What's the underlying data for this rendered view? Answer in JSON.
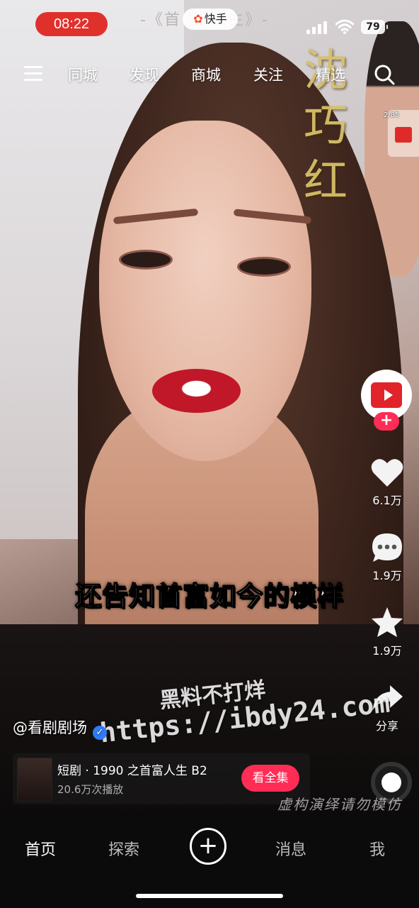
{
  "status_bar": {
    "time": "08:22",
    "top_title": "-《首 富 人生》-",
    "app_badge": "快手",
    "battery": "79"
  },
  "top_nav": {
    "tabs": [
      "同城",
      "发现",
      "商城",
      "关注",
      "精选"
    ]
  },
  "video_overlay": {
    "calligraphy": [
      "沈",
      "巧",
      "红"
    ],
    "subtitle": "还告知首富如今的模样",
    "watermark_line1": "黑料不打烊",
    "watermark_line2": "https://ibdy24.com",
    "disclaimer": "虚构演绎请勿模仿",
    "red_packet_count": "2/85"
  },
  "side_actions": {
    "like_count": "6.1万",
    "comment_count": "1.9万",
    "favorite_count": "1.9万",
    "share_label": "分享",
    "follow_symbol": "+"
  },
  "author": {
    "handle": "@看剧剧场"
  },
  "drama_card": {
    "title": "短剧 · 1990 之首富人生 B2",
    "views": "20.6万次播放",
    "watch_all": "看全集"
  },
  "tab_bar": {
    "home": "首页",
    "explore": "探索",
    "create": "+",
    "messages": "消息",
    "me": "我"
  },
  "colors": {
    "accent": "#ff2d55",
    "time_pill": "#e0302c",
    "calligraphy": "#d7c069"
  }
}
